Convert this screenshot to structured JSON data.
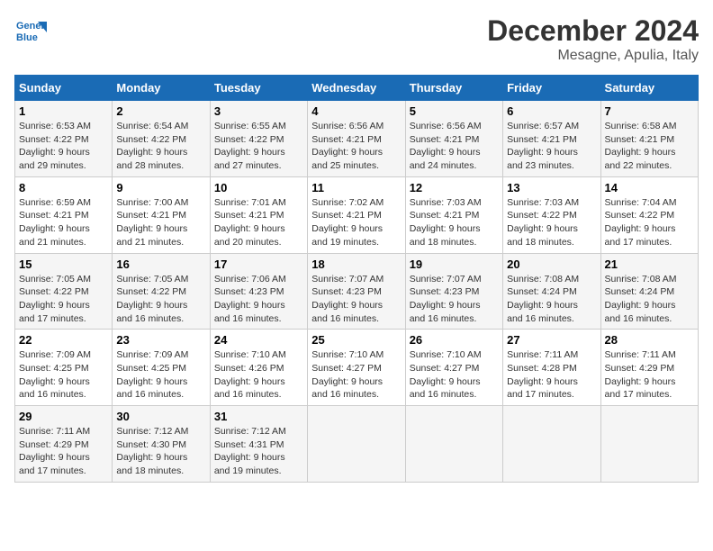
{
  "logo": {
    "line1": "General",
    "line2": "Blue"
  },
  "title": "December 2024",
  "subtitle": "Mesagne, Apulia, Italy",
  "days_of_week": [
    "Sunday",
    "Monday",
    "Tuesday",
    "Wednesday",
    "Thursday",
    "Friday",
    "Saturday"
  ],
  "weeks": [
    [
      {
        "day": "1",
        "info": "Sunrise: 6:53 AM\nSunset: 4:22 PM\nDaylight: 9 hours\nand 29 minutes."
      },
      {
        "day": "2",
        "info": "Sunrise: 6:54 AM\nSunset: 4:22 PM\nDaylight: 9 hours\nand 28 minutes."
      },
      {
        "day": "3",
        "info": "Sunrise: 6:55 AM\nSunset: 4:22 PM\nDaylight: 9 hours\nand 27 minutes."
      },
      {
        "day": "4",
        "info": "Sunrise: 6:56 AM\nSunset: 4:21 PM\nDaylight: 9 hours\nand 25 minutes."
      },
      {
        "day": "5",
        "info": "Sunrise: 6:56 AM\nSunset: 4:21 PM\nDaylight: 9 hours\nand 24 minutes."
      },
      {
        "day": "6",
        "info": "Sunrise: 6:57 AM\nSunset: 4:21 PM\nDaylight: 9 hours\nand 23 minutes."
      },
      {
        "day": "7",
        "info": "Sunrise: 6:58 AM\nSunset: 4:21 PM\nDaylight: 9 hours\nand 22 minutes."
      }
    ],
    [
      {
        "day": "8",
        "info": "Sunrise: 6:59 AM\nSunset: 4:21 PM\nDaylight: 9 hours\nand 21 minutes."
      },
      {
        "day": "9",
        "info": "Sunrise: 7:00 AM\nSunset: 4:21 PM\nDaylight: 9 hours\nand 21 minutes."
      },
      {
        "day": "10",
        "info": "Sunrise: 7:01 AM\nSunset: 4:21 PM\nDaylight: 9 hours\nand 20 minutes."
      },
      {
        "day": "11",
        "info": "Sunrise: 7:02 AM\nSunset: 4:21 PM\nDaylight: 9 hours\nand 19 minutes."
      },
      {
        "day": "12",
        "info": "Sunrise: 7:03 AM\nSunset: 4:21 PM\nDaylight: 9 hours\nand 18 minutes."
      },
      {
        "day": "13",
        "info": "Sunrise: 7:03 AM\nSunset: 4:22 PM\nDaylight: 9 hours\nand 18 minutes."
      },
      {
        "day": "14",
        "info": "Sunrise: 7:04 AM\nSunset: 4:22 PM\nDaylight: 9 hours\nand 17 minutes."
      }
    ],
    [
      {
        "day": "15",
        "info": "Sunrise: 7:05 AM\nSunset: 4:22 PM\nDaylight: 9 hours\nand 17 minutes."
      },
      {
        "day": "16",
        "info": "Sunrise: 7:05 AM\nSunset: 4:22 PM\nDaylight: 9 hours\nand 16 minutes."
      },
      {
        "day": "17",
        "info": "Sunrise: 7:06 AM\nSunset: 4:23 PM\nDaylight: 9 hours\nand 16 minutes."
      },
      {
        "day": "18",
        "info": "Sunrise: 7:07 AM\nSunset: 4:23 PM\nDaylight: 9 hours\nand 16 minutes."
      },
      {
        "day": "19",
        "info": "Sunrise: 7:07 AM\nSunset: 4:23 PM\nDaylight: 9 hours\nand 16 minutes."
      },
      {
        "day": "20",
        "info": "Sunrise: 7:08 AM\nSunset: 4:24 PM\nDaylight: 9 hours\nand 16 minutes."
      },
      {
        "day": "21",
        "info": "Sunrise: 7:08 AM\nSunset: 4:24 PM\nDaylight: 9 hours\nand 16 minutes."
      }
    ],
    [
      {
        "day": "22",
        "info": "Sunrise: 7:09 AM\nSunset: 4:25 PM\nDaylight: 9 hours\nand 16 minutes."
      },
      {
        "day": "23",
        "info": "Sunrise: 7:09 AM\nSunset: 4:25 PM\nDaylight: 9 hours\nand 16 minutes."
      },
      {
        "day": "24",
        "info": "Sunrise: 7:10 AM\nSunset: 4:26 PM\nDaylight: 9 hours\nand 16 minutes."
      },
      {
        "day": "25",
        "info": "Sunrise: 7:10 AM\nSunset: 4:27 PM\nDaylight: 9 hours\nand 16 minutes."
      },
      {
        "day": "26",
        "info": "Sunrise: 7:10 AM\nSunset: 4:27 PM\nDaylight: 9 hours\nand 16 minutes."
      },
      {
        "day": "27",
        "info": "Sunrise: 7:11 AM\nSunset: 4:28 PM\nDaylight: 9 hours\nand 17 minutes."
      },
      {
        "day": "28",
        "info": "Sunrise: 7:11 AM\nSunset: 4:29 PM\nDaylight: 9 hours\nand 17 minutes."
      }
    ],
    [
      {
        "day": "29",
        "info": "Sunrise: 7:11 AM\nSunset: 4:29 PM\nDaylight: 9 hours\nand 17 minutes."
      },
      {
        "day": "30",
        "info": "Sunrise: 7:12 AM\nSunset: 4:30 PM\nDaylight: 9 hours\nand 18 minutes."
      },
      {
        "day": "31",
        "info": "Sunrise: 7:12 AM\nSunset: 4:31 PM\nDaylight: 9 hours\nand 19 minutes."
      },
      null,
      null,
      null,
      null
    ]
  ]
}
